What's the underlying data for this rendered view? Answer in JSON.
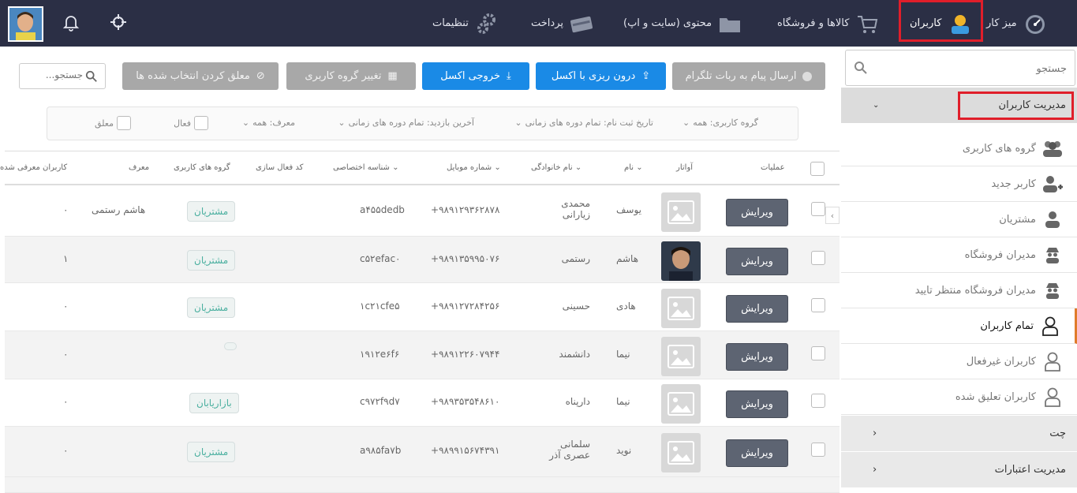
{
  "topbar": {
    "items": [
      {
        "label": "میز کار",
        "icon": "dashboard-gauge-icon"
      },
      {
        "label": "کاربران",
        "icon": "user-icon"
      },
      {
        "label": "کالاها و فروشگاه",
        "icon": "shopping-cart-icon"
      },
      {
        "label": "محتوی (سایت و اپ)",
        "icon": "folder-icon"
      },
      {
        "label": "پرداخت",
        "icon": "credit-card-icon"
      },
      {
        "label": "تنظیمات",
        "icon": "gears-icon"
      }
    ],
    "highlight_color": "#e01e2a"
  },
  "sidebar": {
    "search_placeholder": "جستجو",
    "section_user_management": "مدیریت کاربران",
    "items": [
      {
        "label": "گروه های کاربری",
        "icon": "users-group-icon"
      },
      {
        "label": "کاربر جدید",
        "icon": "user-plus-icon"
      },
      {
        "label": "مشتریان",
        "icon": "user-icon"
      },
      {
        "label": "مدیران فروشگاه",
        "icon": "spy-icon"
      },
      {
        "label": "مدیران فروشگاه منتظر تایید",
        "icon": "spy-icon"
      },
      {
        "label": "تمام کاربران",
        "icon": "user-outline-icon"
      },
      {
        "label": "کاربران غیرفعال",
        "icon": "user-outline-icon"
      },
      {
        "label": "کاربران تعلیق شده",
        "icon": "user-outline-icon"
      }
    ],
    "section_chat": "چت",
    "section_credit": "مدیریت اعتبارات",
    "active_accent": "#e07b2a"
  },
  "toolbar": {
    "telegram": "ارسال پیام به ربات تلگرام",
    "import_excel": "درون ریزی با اکسل",
    "export_excel": "خروجی اکسل",
    "change_group": "تغییر گروه کاربری",
    "suspend_selected": "معلق کردن انتخاب شده ها",
    "search_placeholder": "جستجو...",
    "accent_blue": "#1a8ae6"
  },
  "filters": {
    "group": "گروه کاربری:  همه",
    "register_date": "تاریخ ثبت نام:  تمام دوره های زمانی",
    "last_visit": "آخرین بازدید:  تمام دوره های زمانی",
    "referrer": "معرف:  همه",
    "active": "فعال",
    "suspended": "معلق"
  },
  "table": {
    "headers": {
      "operations": "عملیات",
      "avatar": "آواتار",
      "first_name": "نام",
      "last_name": "نام خانوادگی",
      "mobile": "شماره موبایل",
      "code": "شناسه اختصاصی",
      "activation": "کد فعال سازی",
      "groups": "گروه های کاربری",
      "referrer": "معرف",
      "referred": "کاربران معرفی شده"
    },
    "edit_label": "ویرایش",
    "rows": [
      {
        "first": "یوسف",
        "last": "محمدی\nزیارانی",
        "mobile": "۹۸۹۱۲۹۳۶۲۸۷۸+",
        "code": "a۴۵۵dedb",
        "group": "مشتریان",
        "referrer": "هاشم رستمی",
        "referred": "۰"
      },
      {
        "first": "هاشم",
        "last": "رستمی",
        "mobile": "۹۸۹۱۳۵۹۹۵۰۷۶+",
        "code": "c۵۲efac۰",
        "group": "مشتریان",
        "referrer": "",
        "referred": "۱"
      },
      {
        "first": "هادی",
        "last": "حسینی",
        "mobile": "۹۸۹۱۲۷۲۸۴۲۵۶+",
        "code": "۱c۲۱cfe۵",
        "group": "مشتریان",
        "referrer": "",
        "referred": "۰"
      },
      {
        "first": "نیما",
        "last": "دانشمند",
        "mobile": "۹۸۹۱۲۲۶۰۷۹۴۴+",
        "code": "۱۹۱۲e۶f۶",
        "group": "",
        "referrer": "",
        "referred": "۰"
      },
      {
        "first": "نیما",
        "last": "دارپناه",
        "mobile": "۹۸۹۳۵۳۵۴۸۶۱۰+",
        "code": "c۹۷۲f۹d۷",
        "group": "بازاریابان",
        "referrer": "",
        "referred": "۰"
      },
      {
        "first": "نوید",
        "last": "سلمانی\nعصری آذر",
        "mobile": "۹۸۹۹۱۵۶۷۴۳۹۱+",
        "code": "a۹۸۵fa۷b",
        "group": "مشتریان",
        "referrer": "",
        "referred": "۰"
      }
    ]
  }
}
